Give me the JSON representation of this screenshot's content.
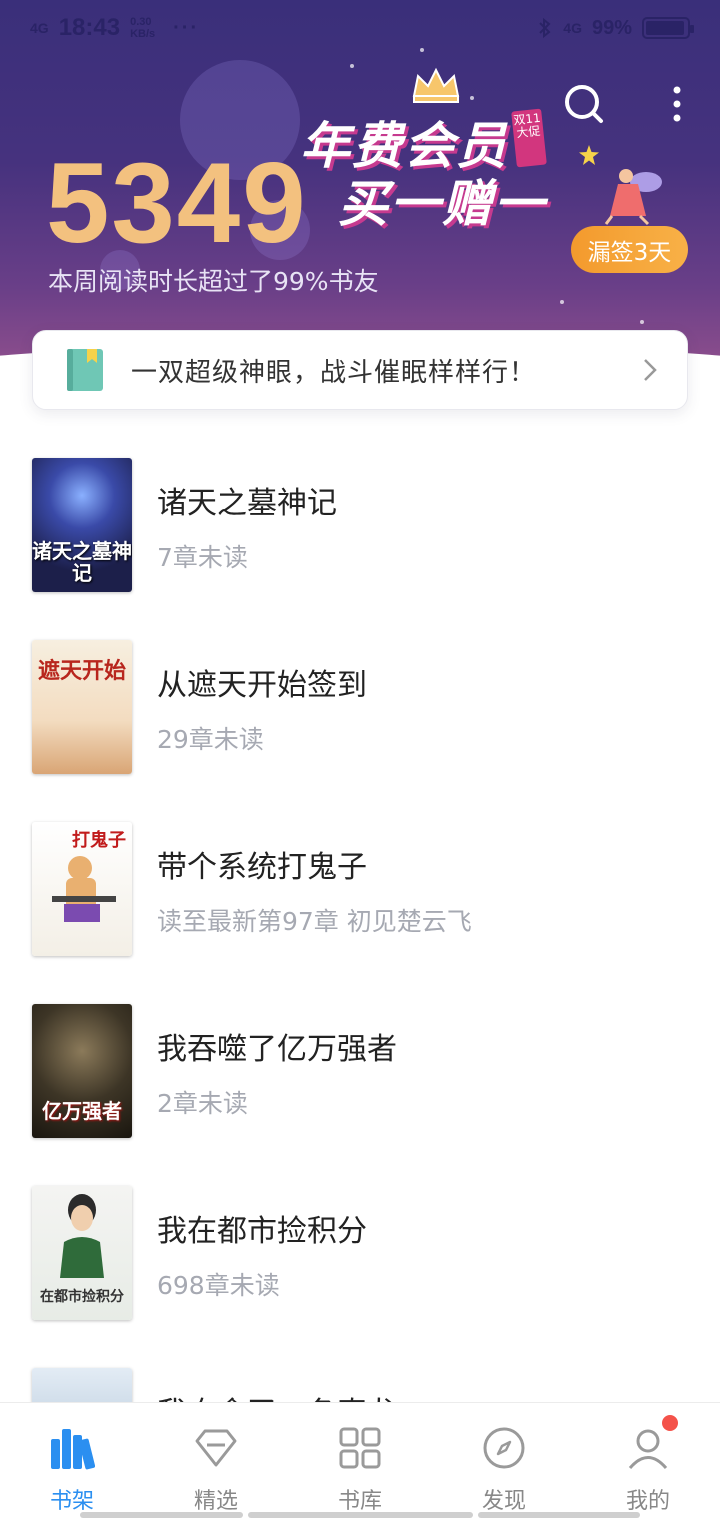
{
  "status_bar": {
    "network": "4G",
    "time": "18:43",
    "speed_value": "0.30",
    "speed_unit": "KB/s",
    "more": "···",
    "right_network": "4G",
    "battery": "99%"
  },
  "header": {
    "reading_stat": "5349",
    "reading_desc": "本周阅读时长超过了99%书友",
    "promo_line1": "年费会员",
    "promo_line2": "买一赠一",
    "promo_tag": "双11大促",
    "sign_button": "漏签3天"
  },
  "notice": {
    "text": "一双超级神眼，战斗催眠样样行！"
  },
  "books": [
    {
      "title": "诸天之墓神记",
      "status": "7章未读",
      "cover_text": "诸天之墓神记"
    },
    {
      "title": "从遮天开始签到",
      "status": "29章未读",
      "cover_text": "遮天开始"
    },
    {
      "title": "带个系统打鬼子",
      "status": "读至最新第97章 初见楚云飞",
      "cover_text": "打鬼子"
    },
    {
      "title": "我吞噬了亿万强者",
      "status": "2章未读",
      "cover_text": "亿万强者"
    },
    {
      "title": "我在都市捡积分",
      "status": "698章未读",
      "cover_text": "在都市捡积分"
    },
    {
      "title": "我夺舍了一条真龙",
      "status": "",
      "cover_text": ""
    }
  ],
  "bottom_nav": [
    {
      "label": "书架",
      "icon": "bookshelf-icon",
      "active": true
    },
    {
      "label": "精选",
      "icon": "diamond-icon",
      "active": false
    },
    {
      "label": "书库",
      "icon": "grid-icon",
      "active": false
    },
    {
      "label": "发现",
      "icon": "compass-icon",
      "active": false
    },
    {
      "label": "我的",
      "icon": "user-icon",
      "active": false
    }
  ],
  "colors": {
    "accent": "#2b8ff0",
    "hero_bg": "#46327e",
    "stat_gold": "#f3c17f",
    "sign_orange": "#f39a2d",
    "badge_red": "#f4524a"
  }
}
